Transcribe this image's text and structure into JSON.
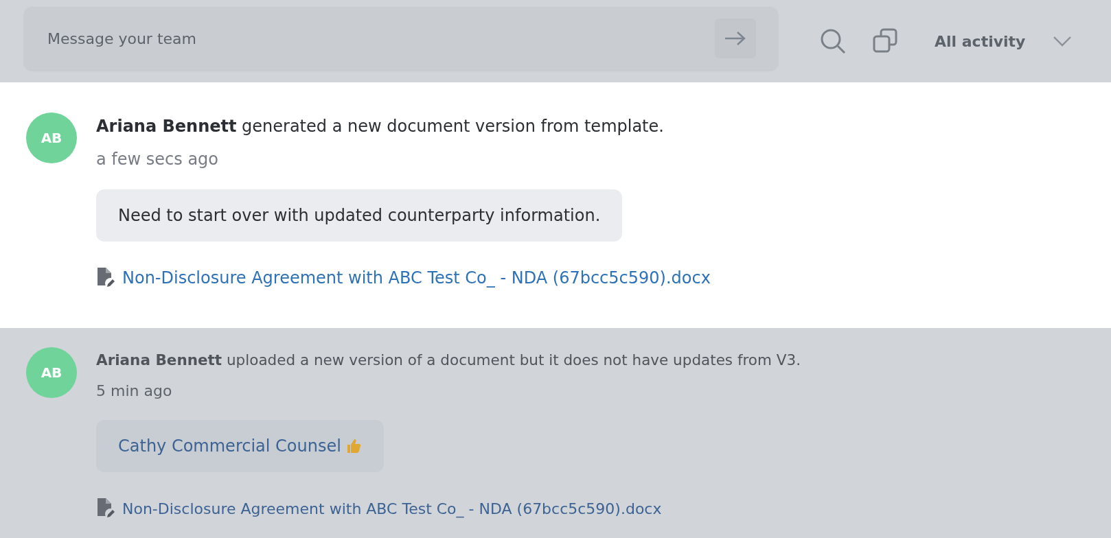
{
  "composer": {
    "placeholder": "Message your team"
  },
  "filter": {
    "label": "All activity"
  },
  "activities": [
    {
      "focused": true,
      "avatar": "AB",
      "actor": "Ariana Bennett",
      "action": "generated a new document version from template.",
      "time": "a few secs ago",
      "note": {
        "kind": "comment",
        "text": "Need to start over with updated counterparty information."
      },
      "document": "Non-Disclosure Agreement with ABC Test Co_ - NDA (67bcc5c590).docx"
    },
    {
      "focused": false,
      "avatar": "AB",
      "actor": "Ariana Bennett",
      "action": "uploaded a new version of a document but it does not have updates from V3.",
      "time": "5 min ago",
      "note": {
        "kind": "reaction",
        "text": "Cathy Commercial Counsel"
      },
      "document": "Non-Disclosure Agreement with ABC Test Co_ - NDA (67bcc5c590).docx"
    }
  ]
}
